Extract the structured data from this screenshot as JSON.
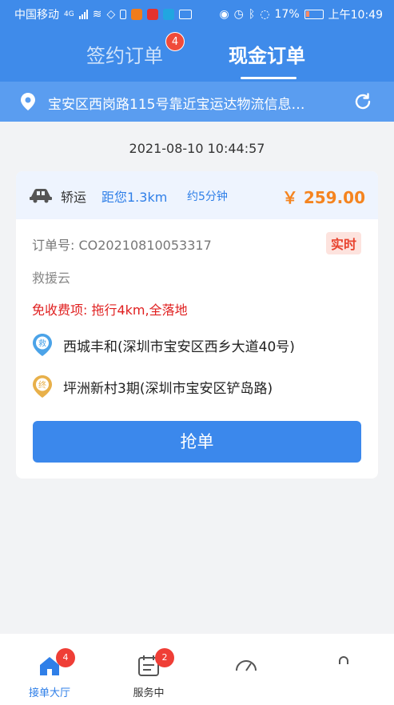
{
  "status_bar": {
    "carrier": "中国移动",
    "network": "4G",
    "battery": "17%",
    "time": "上午10:49"
  },
  "tabs": [
    {
      "label": "签约订单",
      "badge": "4",
      "active": false
    },
    {
      "label": "现金订单",
      "active": true
    }
  ],
  "location": {
    "address": "宝安区西岗路115号靠近宝运达物流信息…",
    "icon": "location-pin-icon",
    "refresh_icon": "refresh-icon"
  },
  "order": {
    "timestamp": "2021-08-10 10:44:57",
    "vehicle_type": "轿运",
    "distance": "距您1.3km",
    "eta": "约5分钟",
    "price": "￥ 259.00",
    "order_number": "订单号: CO20210810053317",
    "realtime_label": "实时",
    "company": "救援云",
    "fee_note": "免收费项: 拖行4km,全落地",
    "start": {
      "marker": "救",
      "address": "西城丰和(深圳市宝安区西乡大道40号)"
    },
    "end": {
      "marker": "终",
      "address": "坪洲新村3期(深圳市宝安区铲岛路)"
    },
    "grab_label": "抢单"
  },
  "bottom_nav": [
    {
      "label": "接单大厅",
      "icon": "home-icon",
      "badge": "4",
      "active": true
    },
    {
      "label": "服务中",
      "icon": "service-list-icon",
      "badge": "2"
    },
    {
      "label": "",
      "icon": "dashboard-icon"
    },
    {
      "label": "",
      "icon": "profile-icon"
    }
  ],
  "colors": {
    "header_blue": "#3f8bea",
    "accent_blue": "#2f7fe8",
    "price_orange": "#f5841f",
    "alert_red": "#e02020"
  }
}
